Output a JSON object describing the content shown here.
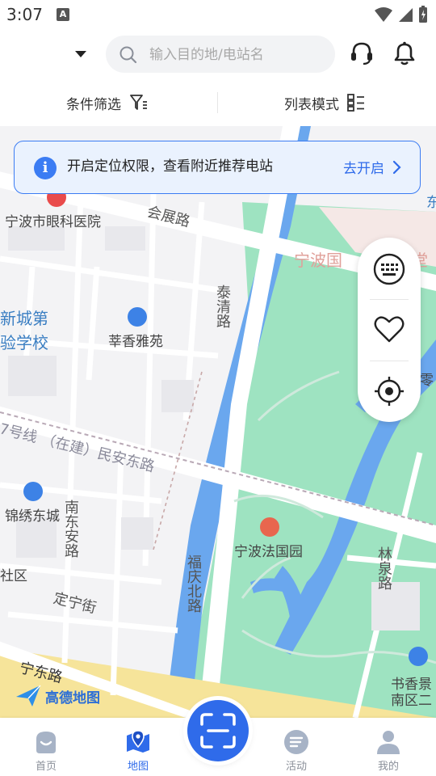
{
  "status_bar": {
    "time": "3:07",
    "a_badge": "A"
  },
  "header": {
    "search": {
      "placeholder": "输入目的地/电站名"
    },
    "icons": [
      "chevron-down-icon",
      "search-icon",
      "headset-icon",
      "bell-icon"
    ]
  },
  "filters": {
    "condition_label": "条件筛选",
    "list_mode_label": "列表模式"
  },
  "banner": {
    "text": "开启定位权限，查看附近推荐电站",
    "action_label": "去开启"
  },
  "map": {
    "labels": {
      "eye_hospital": "宁波市眼科医院",
      "huizhan_road": "会展路",
      "xincheng_school_1": "新城第",
      "xincheng_school_2": "验学校",
      "xinxiang": "莘香雅苑",
      "taiqing_road": "泰清路",
      "ningbo_guo": "宁波国",
      "ningbo_guo_2": "堂",
      "metro_line": "7号线 （在建）民安东路",
      "jinxiu": "锦绣东城",
      "nandong_road": "南东安路",
      "she_qu": "社区",
      "dingning": "定宁街",
      "fuqing_road": "福庆北路",
      "fa_park": "宁波法国园",
      "linquan_road": "林泉路",
      "shuxiang": "书香景",
      "nanqu": "南区二",
      "ningdong_road": "宁东路",
      "ling": "零",
      "dong": "东"
    },
    "logo_text": "高德地图"
  },
  "side_panel": {
    "buttons": [
      "keyboard-icon",
      "heart-icon",
      "locate-icon"
    ]
  },
  "tabs": [
    {
      "label": "首页",
      "icon": "home-icon"
    },
    {
      "label": "地图",
      "icon": "map-icon"
    },
    {
      "label": "活动",
      "icon": "activity-icon"
    },
    {
      "label": "我的",
      "icon": "profile-icon"
    }
  ],
  "colors": {
    "accent": "#2f6bea",
    "park": "#9ee3c1",
    "water": "#6aa7ee"
  }
}
